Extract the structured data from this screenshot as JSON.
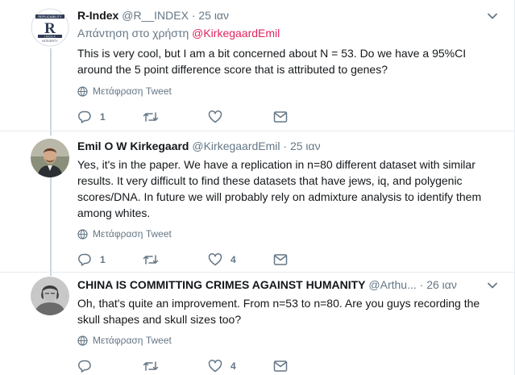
{
  "tweets": [
    {
      "fullname": "R-Index",
      "screenname": "@R__INDEX",
      "time": "· 25 ιαν",
      "reply_prefix": "Απάντηση στο χρήστη",
      "reply_mention": "@KirkegaardEmil",
      "text": "This is very cool, but I am a bit concerned about N = 53.  Do we have a 95%CI around the 5 point difference score that is attributed to genes?",
      "translate": "Μετάφραση Tweet",
      "reply_count": "1",
      "retweet_count": "",
      "like_count": "",
      "avatar": {
        "top_text": "REPLICABILITY",
        "letter": "R",
        "bottom_text": "INTEGRITY",
        "mid_text": "I N D E X"
      }
    },
    {
      "fullname": "Emil O W Kirkegaard",
      "screenname": "@KirkegaardEmil",
      "time": "· 25 ιαν",
      "text": "Yes, it's in the paper. We have a replication in n=80 different dataset with similar results. It very difficult to find these datasets that have jews, iq, and polygenic scores/DNA. In future we will probably rely on admixture analysis to identify them among whites.",
      "translate": "Μετάφραση Tweet",
      "reply_count": "1",
      "retweet_count": "",
      "like_count": "4"
    },
    {
      "fullname": "CHINA IS COMMITTING CRIMES AGAINST HUMANITY",
      "screenname": "@Arthu...",
      "time": "· 26 ιαν",
      "text": "Oh, that's quite an improvement. From n=53 to n=80. Are you guys recording the skull shapes and skull sizes too?",
      "translate": "Μετάφραση Tweet",
      "reply_count": "",
      "retweet_count": "",
      "like_count": "4"
    }
  ],
  "colors": {
    "text": "#14171a",
    "secondary": "#657786",
    "mention": "#e0245e",
    "border": "#e6ecf0",
    "thread_line": "#ccd6dd"
  }
}
